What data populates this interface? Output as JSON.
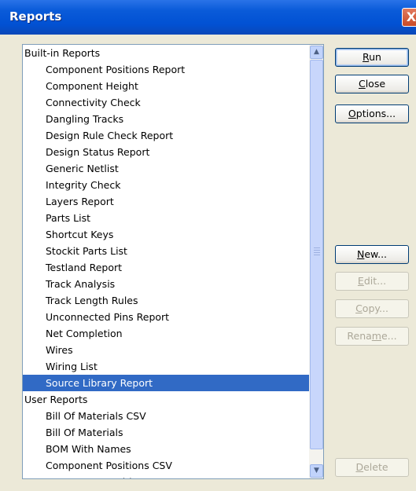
{
  "window": {
    "title": "Reports",
    "close_glyph": "X"
  },
  "list": {
    "items": [
      {
        "label": "Built-in Reports",
        "kind": "group"
      },
      {
        "label": "Component Positions Report",
        "kind": "child"
      },
      {
        "label": "Component Height",
        "kind": "child"
      },
      {
        "label": "Connectivity Check",
        "kind": "child"
      },
      {
        "label": "Dangling Tracks",
        "kind": "child"
      },
      {
        "label": "Design Rule Check Report",
        "kind": "child"
      },
      {
        "label": "Design Status Report",
        "kind": "child"
      },
      {
        "label": "Generic Netlist",
        "kind": "child"
      },
      {
        "label": "Integrity Check",
        "kind": "child"
      },
      {
        "label": "Layers Report",
        "kind": "child"
      },
      {
        "label": "Parts List",
        "kind": "child"
      },
      {
        "label": "Shortcut Keys",
        "kind": "child"
      },
      {
        "label": "Stockit Parts List",
        "kind": "child"
      },
      {
        "label": "Testland Report",
        "kind": "child"
      },
      {
        "label": "Track Analysis",
        "kind": "child"
      },
      {
        "label": "Track Length Rules",
        "kind": "child"
      },
      {
        "label": "Unconnected Pins Report",
        "kind": "child"
      },
      {
        "label": "Net Completion",
        "kind": "child"
      },
      {
        "label": "Wires",
        "kind": "child"
      },
      {
        "label": "Wiring List",
        "kind": "child"
      },
      {
        "label": "Source Library Report",
        "kind": "child",
        "selected": true
      },
      {
        "label": "User Reports",
        "kind": "group"
      },
      {
        "label": "Bill Of Materials CSV",
        "kind": "child"
      },
      {
        "label": "Bill Of Materials",
        "kind": "child"
      },
      {
        "label": "BOM With Names",
        "kind": "child"
      },
      {
        "label": "Component Positions CSV",
        "kind": "child"
      },
      {
        "label": "Component Positions",
        "kind": "child"
      }
    ]
  },
  "buttons": {
    "run": {
      "pre": "",
      "mnemonic": "R",
      "post": "un"
    },
    "close": {
      "pre": "",
      "mnemonic": "C",
      "post": "lose"
    },
    "options": {
      "pre": "",
      "mnemonic": "O",
      "post": "ptions..."
    },
    "new": {
      "pre": "",
      "mnemonic": "N",
      "post": "ew..."
    },
    "edit": {
      "pre": "",
      "mnemonic": "E",
      "post": "dit..."
    },
    "copy": {
      "pre": "",
      "mnemonic": "C",
      "post": "opy..."
    },
    "rename": {
      "pre": "Rena",
      "mnemonic": "m",
      "post": "e..."
    },
    "delete": {
      "pre": "",
      "mnemonic": "D",
      "post": "elete"
    }
  },
  "colors": {
    "selection": "#316AC5",
    "titlebar": "#0A5BD9",
    "face": "#ECE9D8"
  }
}
